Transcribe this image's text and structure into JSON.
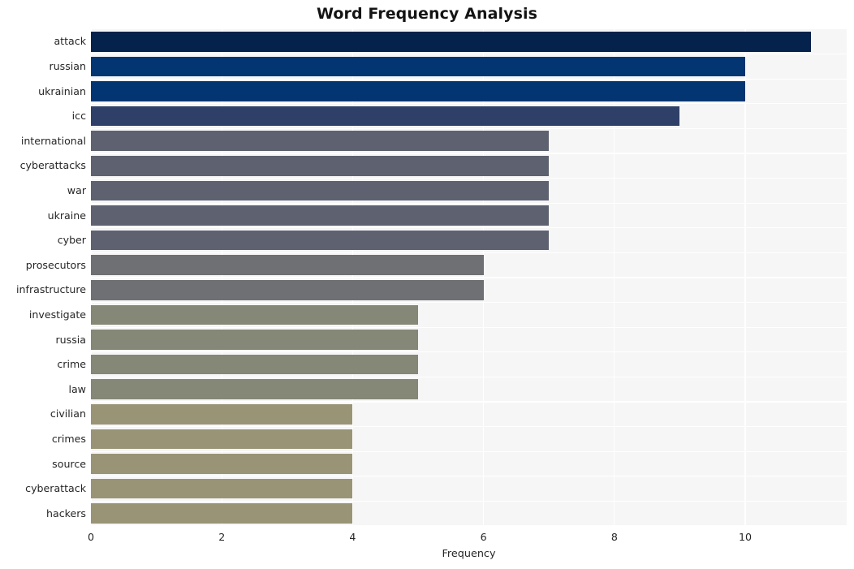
{
  "chart_data": {
    "type": "bar",
    "orientation": "horizontal",
    "title": "Word Frequency Analysis",
    "xlabel": "Frequency",
    "ylabel": "",
    "xlim": [
      0,
      11.55
    ],
    "xticks": [
      0,
      2,
      4,
      6,
      8,
      10
    ],
    "xticklabels": [
      "0",
      "2",
      "4",
      "6",
      "8",
      "10"
    ],
    "grid": true,
    "grid_axis": "both",
    "grid_color": "#ffffff",
    "plot_background": "#f6f6f7",
    "figure_background": "#ffffff",
    "legend": "none",
    "categories": [
      "attack",
      "russian",
      "ukrainian",
      "icc",
      "international",
      "cyberattacks",
      "war",
      "ukraine",
      "cyber",
      "prosecutors",
      "infrastructure",
      "investigate",
      "russia",
      "crime",
      "law",
      "civilian",
      "crimes",
      "source",
      "cyberattack",
      "hackers"
    ],
    "values": [
      11,
      10,
      10,
      9,
      7,
      7,
      7,
      7,
      7,
      6,
      6,
      5,
      5,
      5,
      5,
      4,
      4,
      4,
      4,
      4
    ],
    "bar_colors": [
      "#04224b",
      "#033572",
      "#033572",
      "#2f4068",
      "#5e6270",
      "#5e6270",
      "#5e6270",
      "#5e6270",
      "#5e6270",
      "#6f7074",
      "#6f7074",
      "#858777",
      "#858777",
      "#858777",
      "#858777",
      "#9a9476",
      "#9a9476",
      "#9a9476",
      "#9a9476",
      "#9a9476"
    ]
  }
}
